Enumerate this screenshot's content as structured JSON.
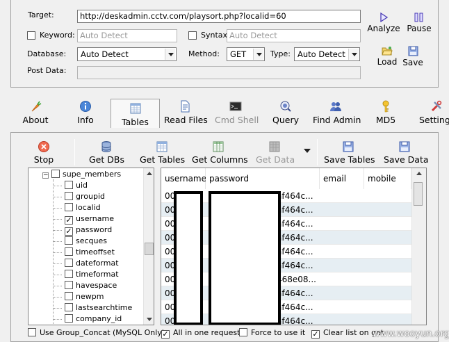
{
  "form": {
    "target_label": "Target:",
    "target_value": "http://deskadmin.cctv.com/playsort.php?localid=60",
    "keyword_label": "Keyword:",
    "keyword_placeholder": "Auto Detect",
    "syntax_label": "Syntax:",
    "syntax_placeholder": "Auto Detect",
    "database_label": "Database:",
    "database_value": "Auto Detect",
    "method_label": "Method:",
    "method_value": "GET",
    "type_label": "Type:",
    "type_value": "Auto Detect",
    "postdata_label": "Post Data:",
    "postdata_value": ""
  },
  "side_buttons": {
    "analyze": "Analyze",
    "pause": "Pause",
    "load": "Load",
    "save": "Save"
  },
  "nav": {
    "about": "About",
    "info": "Info",
    "tables": "Tables",
    "read_files": "Read Files",
    "cmd_shell": "Cmd Shell",
    "query": "Query",
    "find_admin": "Find Admin",
    "md5": "MD5",
    "settings": "Settings"
  },
  "toolbar": {
    "stop": "Stop",
    "get_dbs": "Get DBs",
    "get_tables": "Get Tables",
    "get_columns": "Get Columns",
    "get_data": "Get Data",
    "save_tables": "Save Tables",
    "save_data": "Save Data"
  },
  "tree": {
    "table": "supe_members",
    "columns": [
      {
        "name": "uid",
        "checked": false
      },
      {
        "name": "groupid",
        "checked": false
      },
      {
        "name": "localid",
        "checked": false
      },
      {
        "name": "username",
        "checked": true
      },
      {
        "name": "password",
        "checked": true
      },
      {
        "name": "secques",
        "checked": false
      },
      {
        "name": "timeoffset",
        "checked": false
      },
      {
        "name": "dateformat",
        "checked": false
      },
      {
        "name": "timeformat",
        "checked": false
      },
      {
        "name": "havespace",
        "checked": false
      },
      {
        "name": "newpm",
        "checked": false
      },
      {
        "name": "lastsearchtime",
        "checked": false
      },
      {
        "name": "company_id",
        "checked": false
      }
    ]
  },
  "grid": {
    "headers": [
      "username",
      "password",
      "email",
      "mobile"
    ],
    "rows": [
      {
        "u": "00",
        "p": "af464c..."
      },
      {
        "u": "00",
        "p": "af464c..."
      },
      {
        "u": "00",
        "p": "af464c..."
      },
      {
        "u": "00",
        "p": "af464c..."
      },
      {
        "u": "00",
        "p": "af464c..."
      },
      {
        "u": "00",
        "p": "af464c..."
      },
      {
        "u": "00",
        "p": "468e08..."
      },
      {
        "u": "00",
        "p": "af464c..."
      },
      {
        "u": "00",
        "p": "af464c..."
      },
      {
        "u": "00",
        "p": "af464c..."
      }
    ]
  },
  "options": {
    "group_concat": "Use Group_Concat (MySQL Only)",
    "all_in_one": "All in one request.",
    "force": "Force to use it",
    "clear_list": "Clear list on get"
  },
  "watermark": "www.wooyun.org"
}
